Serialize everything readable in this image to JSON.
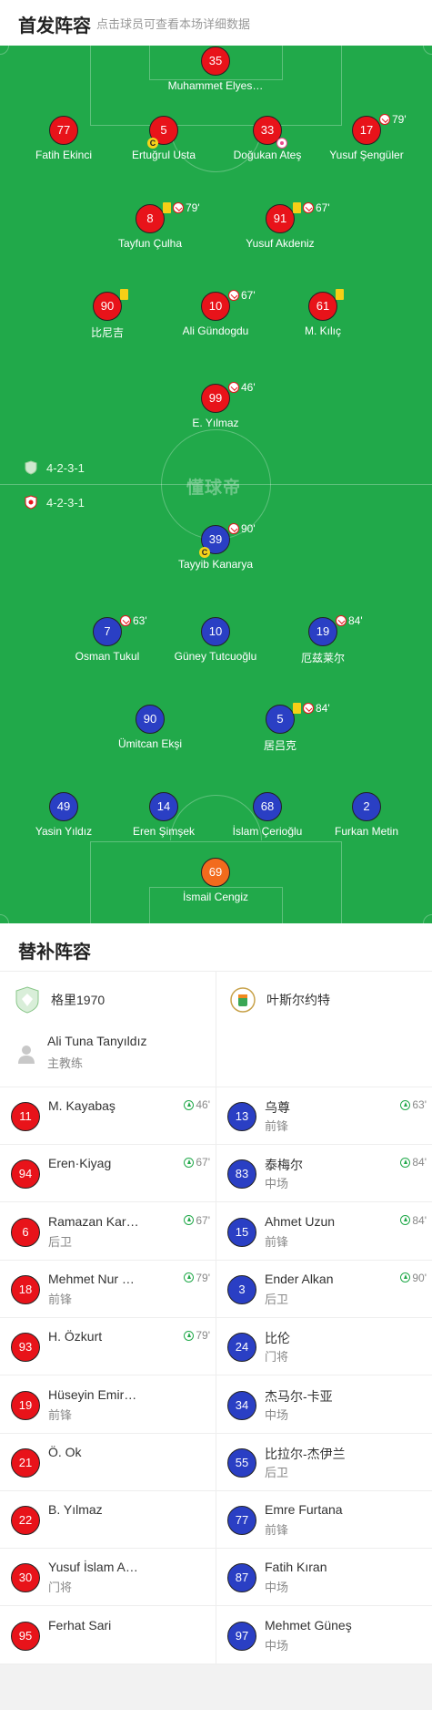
{
  "header": {
    "title": "首发阵容",
    "hint": "点击球员可查看本场详细数据"
  },
  "pitch": {
    "watermark": "懂球帝",
    "formations": {
      "home": "4-2-3-1",
      "away": "4-2-3-1"
    },
    "colors": {
      "grass": "#21a94a",
      "home": "#e8131a",
      "away": "#2a3fc4",
      "away_gk": "#f26b1d"
    }
  },
  "home_lineup": [
    {
      "number": "35",
      "name": "Muhammet Elyes…"
    },
    {
      "number": "77",
      "name": "Fatih Ekinci"
    },
    {
      "number": "5",
      "name": "Ertuğrul Usta",
      "captain": "C"
    },
    {
      "number": "33",
      "name": "Doğukan Ateş",
      "goal": true
    },
    {
      "number": "17",
      "name": "Yusuf Şengüler",
      "sub_off": "79'"
    },
    {
      "number": "8",
      "name": "Tayfun Çulha",
      "card": "yellow",
      "sub_off": "79'"
    },
    {
      "number": "91",
      "name": "Yusuf Akdeniz",
      "card": "yellow",
      "sub_off": "67'"
    },
    {
      "number": "90",
      "name": "比尼吉",
      "card": "yellow"
    },
    {
      "number": "10",
      "name": "Ali Gündogdu",
      "sub_off": "67'"
    },
    {
      "number": "61",
      "name": "M. Kılıç",
      "card": "yellow"
    },
    {
      "number": "99",
      "name": "E. Yılmaz",
      "sub_off": "46'"
    }
  ],
  "away_lineup": [
    {
      "number": "39",
      "name": "Tayyib Kanarya",
      "sub_off": "90'",
      "captain": "C"
    },
    {
      "number": "7",
      "name": "Osman Tukul",
      "sub_off": "63'"
    },
    {
      "number": "10",
      "name": "Güney Tutcuoğlu"
    },
    {
      "number": "19",
      "name": "厄兹莱尔",
      "sub_off": "84'"
    },
    {
      "number": "90",
      "name": "Ümitcan Ekşi"
    },
    {
      "number": "5",
      "name": "居吕克",
      "card": "yellow",
      "sub_off": "84'"
    },
    {
      "number": "49",
      "name": "Yasin Yıldız"
    },
    {
      "number": "14",
      "name": "Eren Şimşek"
    },
    {
      "number": "68",
      "name": "İslam Çerioğlu"
    },
    {
      "number": "2",
      "name": "Furkan Metin"
    },
    {
      "number": "69",
      "name": "İsmail Cengiz"
    }
  ],
  "subs": {
    "title": "替补阵容",
    "home_team": "格里1970",
    "away_team": "叶斯尔约特",
    "coach": {
      "name": "Ali Tuna Tanyıldız",
      "role": "主教练"
    },
    "home": [
      {
        "number": "11",
        "name": "M. Kayabaş",
        "pos": "",
        "in": "46'"
      },
      {
        "number": "94",
        "name": "Eren·Kiyag",
        "pos": "",
        "in": "67'"
      },
      {
        "number": "6",
        "name": "Ramazan Kar…",
        "pos": "后卫",
        "in": "67'"
      },
      {
        "number": "18",
        "name": "Mehmet Nur …",
        "pos": "前锋",
        "in": "79'"
      },
      {
        "number": "93",
        "name": "H. Özkurt",
        "pos": "",
        "in": "79'"
      },
      {
        "number": "19",
        "name": "Hüseyin Emir…",
        "pos": "前锋",
        "in": ""
      },
      {
        "number": "21",
        "name": "Ö. Ok",
        "pos": "",
        "in": ""
      },
      {
        "number": "22",
        "name": "B. Yılmaz",
        "pos": "",
        "in": ""
      },
      {
        "number": "30",
        "name": "Yusuf İslam A…",
        "pos": "门将",
        "in": ""
      },
      {
        "number": "95",
        "name": "Ferhat Sari",
        "pos": "",
        "in": ""
      }
    ],
    "away": [
      {
        "number": "13",
        "name": "乌尊",
        "pos": "前锋",
        "in": "63'"
      },
      {
        "number": "83",
        "name": "泰梅尔",
        "pos": "中场",
        "in": "84'"
      },
      {
        "number": "15",
        "name": "Ahmet Uzun",
        "pos": "前锋",
        "in": "84'"
      },
      {
        "number": "3",
        "name": "Ender Alkan",
        "pos": "后卫",
        "in": "90'"
      },
      {
        "number": "24",
        "name": "比伦",
        "pos": "门将",
        "in": ""
      },
      {
        "number": "34",
        "name": "杰马尔-卡亚",
        "pos": "中场",
        "in": ""
      },
      {
        "number": "55",
        "name": "比拉尔-杰伊兰",
        "pos": "后卫",
        "in": ""
      },
      {
        "number": "77",
        "name": "Emre Furtana",
        "pos": "前锋",
        "in": ""
      },
      {
        "number": "87",
        "name": "Fatih Kıran",
        "pos": "中场",
        "in": ""
      },
      {
        "number": "97",
        "name": "Mehmet Güneş",
        "pos": "中场",
        "in": ""
      }
    ]
  }
}
